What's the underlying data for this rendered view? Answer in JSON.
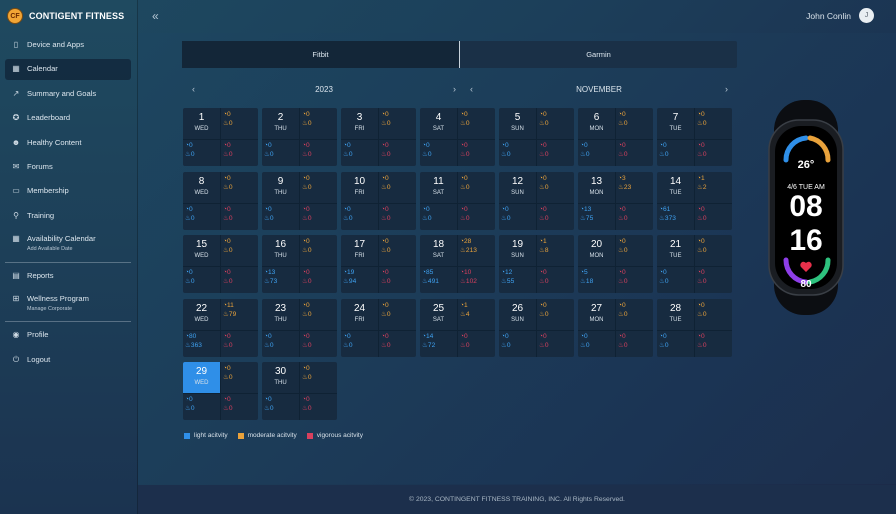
{
  "brand": {
    "name": "CONTIGENT FITNESS",
    "logo_text": "CF"
  },
  "header": {
    "user_name": "John Conlin",
    "avatar_letter": "J"
  },
  "sidebar": {
    "items": [
      {
        "label": "Device and Apps",
        "icon": "phone-icon",
        "glyph": "▯"
      },
      {
        "label": "Calendar",
        "icon": "calendar-icon",
        "glyph": "▦"
      },
      {
        "label": "Summary and Goals",
        "icon": "trend-icon",
        "glyph": "↗"
      },
      {
        "label": "Leaderboard",
        "icon": "medal-icon",
        "glyph": "✪"
      },
      {
        "label": "Healthy Content",
        "icon": "smile-icon",
        "glyph": "☻"
      },
      {
        "label": "Forums",
        "icon": "chat-icon",
        "glyph": "✉"
      },
      {
        "label": "Membership",
        "icon": "card-icon",
        "glyph": "▭"
      },
      {
        "label": "Training",
        "icon": "run-icon",
        "glyph": "⚲"
      },
      {
        "label": "Availability Calendar",
        "sub": "Add Available Date",
        "icon": "calendar-add-icon",
        "glyph": "▦"
      },
      {
        "label": "Reports",
        "icon": "report-icon",
        "glyph": "▤"
      },
      {
        "label": "Wellness Program",
        "sub": "Manage Corporate",
        "icon": "program-icon",
        "glyph": "⊞"
      },
      {
        "label": "Profile",
        "icon": "profile-icon",
        "glyph": "◉"
      },
      {
        "label": "Logout",
        "icon": "power-icon",
        "glyph": "⏻"
      }
    ]
  },
  "tabs": [
    {
      "label": "Fitbit"
    },
    {
      "label": "Garmin"
    }
  ],
  "year_nav": {
    "label": "2023",
    "prev": "‹",
    "next": "›"
  },
  "month_nav": {
    "label": "NOVEMBER",
    "prev": "‹",
    "next": "›"
  },
  "selected_day": 29,
  "days": [
    {
      "n": "1",
      "w": "WED",
      "a": "0",
      "b": "0",
      "c": "0",
      "d": "0",
      "e": "0",
      "f": "0"
    },
    {
      "n": "2",
      "w": "THU",
      "a": "0",
      "b": "0",
      "c": "0",
      "d": "0",
      "e": "0",
      "f": "0"
    },
    {
      "n": "3",
      "w": "FRI",
      "a": "0",
      "b": "0",
      "c": "0",
      "d": "0",
      "e": "0",
      "f": "0"
    },
    {
      "n": "4",
      "w": "SAT",
      "a": "0",
      "b": "0",
      "c": "0",
      "d": "0",
      "e": "0",
      "f": "0"
    },
    {
      "n": "5",
      "w": "SUN",
      "a": "0",
      "b": "0",
      "c": "0",
      "d": "0",
      "e": "0",
      "f": "0"
    },
    {
      "n": "6",
      "w": "MON",
      "a": "0",
      "b": "0",
      "c": "0",
      "d": "0",
      "e": "0",
      "f": "0"
    },
    {
      "n": "7",
      "w": "TUE",
      "a": "0",
      "b": "0",
      "c": "0",
      "d": "0",
      "e": "0",
      "f": "0"
    },
    {
      "n": "8",
      "w": "WED",
      "a": "0",
      "b": "0",
      "c": "0",
      "d": "0",
      "e": "0",
      "f": "0"
    },
    {
      "n": "9",
      "w": "THU",
      "a": "0",
      "b": "0",
      "c": "0",
      "d": "0",
      "e": "0",
      "f": "0"
    },
    {
      "n": "10",
      "w": "FRI",
      "a": "0",
      "b": "0",
      "c": "0",
      "d": "0",
      "e": "0",
      "f": "0"
    },
    {
      "n": "11",
      "w": "SAT",
      "a": "0",
      "b": "0",
      "c": "0",
      "d": "0",
      "e": "0",
      "f": "0"
    },
    {
      "n": "12",
      "w": "SUN",
      "a": "0",
      "b": "0",
      "c": "0",
      "d": "0",
      "e": "0",
      "f": "0"
    },
    {
      "n": "13",
      "w": "MON",
      "a": "3",
      "b": "23",
      "c": "13",
      "d": "75",
      "e": "0",
      "f": "0"
    },
    {
      "n": "14",
      "w": "TUE",
      "a": "1",
      "b": "2",
      "c": "61",
      "d": "373",
      "e": "0",
      "f": "0"
    },
    {
      "n": "15",
      "w": "WED",
      "a": "0",
      "b": "0",
      "c": "0",
      "d": "0",
      "e": "0",
      "f": "0"
    },
    {
      "n": "16",
      "w": "THU",
      "a": "0",
      "b": "0",
      "c": "13",
      "d": "73",
      "e": "0",
      "f": "0"
    },
    {
      "n": "17",
      "w": "FRI",
      "a": "0",
      "b": "0",
      "c": "19",
      "d": "94",
      "e": "0",
      "f": "0"
    },
    {
      "n": "18",
      "w": "SAT",
      "a": "28",
      "b": "213",
      "c": "85",
      "d": "491",
      "e": "10",
      "f": "102"
    },
    {
      "n": "19",
      "w": "SUN",
      "a": "1",
      "b": "8",
      "c": "12",
      "d": "55",
      "e": "0",
      "f": "0"
    },
    {
      "n": "20",
      "w": "MON",
      "a": "0",
      "b": "0",
      "c": "5",
      "d": "18",
      "e": "0",
      "f": "0"
    },
    {
      "n": "21",
      "w": "TUE",
      "a": "0",
      "b": "0",
      "c": "0",
      "d": "0",
      "e": "0",
      "f": "0"
    },
    {
      "n": "22",
      "w": "WED",
      "a": "11",
      "b": "79",
      "c": "80",
      "d": "363",
      "e": "0",
      "f": "0"
    },
    {
      "n": "23",
      "w": "THU",
      "a": "0",
      "b": "0",
      "c": "0",
      "d": "0",
      "e": "0",
      "f": "0"
    },
    {
      "n": "24",
      "w": "FRI",
      "a": "0",
      "b": "0",
      "c": "0",
      "d": "0",
      "e": "0",
      "f": "0"
    },
    {
      "n": "25",
      "w": "SAT",
      "a": "1",
      "b": "4",
      "c": "14",
      "d": "72",
      "e": "0",
      "f": "0"
    },
    {
      "n": "26",
      "w": "SUN",
      "a": "0",
      "b": "0",
      "c": "0",
      "d": "0",
      "e": "0",
      "f": "0"
    },
    {
      "n": "27",
      "w": "MON",
      "a": "0",
      "b": "0",
      "c": "0",
      "d": "0",
      "e": "0",
      "f": "0"
    },
    {
      "n": "28",
      "w": "TUE",
      "a": "0",
      "b": "0",
      "c": "0",
      "d": "0",
      "e": "0",
      "f": "0"
    },
    {
      "n": "29",
      "w": "WED",
      "a": "0",
      "b": "0",
      "c": "0",
      "d": "0",
      "e": "0",
      "f": "0"
    },
    {
      "n": "30",
      "w": "THU",
      "a": "0",
      "b": "0",
      "c": "0",
      "d": "0",
      "e": "0",
      "f": "0"
    }
  ],
  "legend": [
    {
      "label": "light acitvity",
      "color": "#2f8fe8"
    },
    {
      "label": "moderate acitvity",
      "color": "#e9a23b"
    },
    {
      "label": "vigorous acitvity",
      "color": "#d8405e"
    }
  ],
  "watch": {
    "temp": "26°",
    "date": "4/6 TUE AM",
    "hour": "08",
    "minute": "16",
    "heart": "80"
  },
  "footer": {
    "text": "© 2023, CONTINGENT FITNESS TRAINING, INC. All Rights Reserved."
  }
}
